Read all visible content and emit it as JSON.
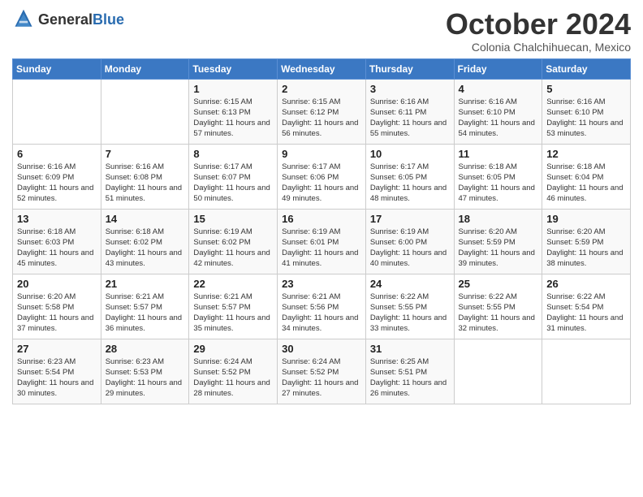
{
  "header": {
    "logo_general": "General",
    "logo_blue": "Blue",
    "month_title": "October 2024",
    "subtitle": "Colonia Chalchihuecan, Mexico"
  },
  "days_of_week": [
    "Sunday",
    "Monday",
    "Tuesday",
    "Wednesday",
    "Thursday",
    "Friday",
    "Saturday"
  ],
  "weeks": [
    [
      {
        "day": "",
        "info": ""
      },
      {
        "day": "",
        "info": ""
      },
      {
        "day": "1",
        "info": "Sunrise: 6:15 AM\nSunset: 6:13 PM\nDaylight: 11 hours and 57 minutes."
      },
      {
        "day": "2",
        "info": "Sunrise: 6:15 AM\nSunset: 6:12 PM\nDaylight: 11 hours and 56 minutes."
      },
      {
        "day": "3",
        "info": "Sunrise: 6:16 AM\nSunset: 6:11 PM\nDaylight: 11 hours and 55 minutes."
      },
      {
        "day": "4",
        "info": "Sunrise: 6:16 AM\nSunset: 6:10 PM\nDaylight: 11 hours and 54 minutes."
      },
      {
        "day": "5",
        "info": "Sunrise: 6:16 AM\nSunset: 6:10 PM\nDaylight: 11 hours and 53 minutes."
      }
    ],
    [
      {
        "day": "6",
        "info": "Sunrise: 6:16 AM\nSunset: 6:09 PM\nDaylight: 11 hours and 52 minutes."
      },
      {
        "day": "7",
        "info": "Sunrise: 6:16 AM\nSunset: 6:08 PM\nDaylight: 11 hours and 51 minutes."
      },
      {
        "day": "8",
        "info": "Sunrise: 6:17 AM\nSunset: 6:07 PM\nDaylight: 11 hours and 50 minutes."
      },
      {
        "day": "9",
        "info": "Sunrise: 6:17 AM\nSunset: 6:06 PM\nDaylight: 11 hours and 49 minutes."
      },
      {
        "day": "10",
        "info": "Sunrise: 6:17 AM\nSunset: 6:05 PM\nDaylight: 11 hours and 48 minutes."
      },
      {
        "day": "11",
        "info": "Sunrise: 6:18 AM\nSunset: 6:05 PM\nDaylight: 11 hours and 47 minutes."
      },
      {
        "day": "12",
        "info": "Sunrise: 6:18 AM\nSunset: 6:04 PM\nDaylight: 11 hours and 46 minutes."
      }
    ],
    [
      {
        "day": "13",
        "info": "Sunrise: 6:18 AM\nSunset: 6:03 PM\nDaylight: 11 hours and 45 minutes."
      },
      {
        "day": "14",
        "info": "Sunrise: 6:18 AM\nSunset: 6:02 PM\nDaylight: 11 hours and 43 minutes."
      },
      {
        "day": "15",
        "info": "Sunrise: 6:19 AM\nSunset: 6:02 PM\nDaylight: 11 hours and 42 minutes."
      },
      {
        "day": "16",
        "info": "Sunrise: 6:19 AM\nSunset: 6:01 PM\nDaylight: 11 hours and 41 minutes."
      },
      {
        "day": "17",
        "info": "Sunrise: 6:19 AM\nSunset: 6:00 PM\nDaylight: 11 hours and 40 minutes."
      },
      {
        "day": "18",
        "info": "Sunrise: 6:20 AM\nSunset: 5:59 PM\nDaylight: 11 hours and 39 minutes."
      },
      {
        "day": "19",
        "info": "Sunrise: 6:20 AM\nSunset: 5:59 PM\nDaylight: 11 hours and 38 minutes."
      }
    ],
    [
      {
        "day": "20",
        "info": "Sunrise: 6:20 AM\nSunset: 5:58 PM\nDaylight: 11 hours and 37 minutes."
      },
      {
        "day": "21",
        "info": "Sunrise: 6:21 AM\nSunset: 5:57 PM\nDaylight: 11 hours and 36 minutes."
      },
      {
        "day": "22",
        "info": "Sunrise: 6:21 AM\nSunset: 5:57 PM\nDaylight: 11 hours and 35 minutes."
      },
      {
        "day": "23",
        "info": "Sunrise: 6:21 AM\nSunset: 5:56 PM\nDaylight: 11 hours and 34 minutes."
      },
      {
        "day": "24",
        "info": "Sunrise: 6:22 AM\nSunset: 5:55 PM\nDaylight: 11 hours and 33 minutes."
      },
      {
        "day": "25",
        "info": "Sunrise: 6:22 AM\nSunset: 5:55 PM\nDaylight: 11 hours and 32 minutes."
      },
      {
        "day": "26",
        "info": "Sunrise: 6:22 AM\nSunset: 5:54 PM\nDaylight: 11 hours and 31 minutes."
      }
    ],
    [
      {
        "day": "27",
        "info": "Sunrise: 6:23 AM\nSunset: 5:54 PM\nDaylight: 11 hours and 30 minutes."
      },
      {
        "day": "28",
        "info": "Sunrise: 6:23 AM\nSunset: 5:53 PM\nDaylight: 11 hours and 29 minutes."
      },
      {
        "day": "29",
        "info": "Sunrise: 6:24 AM\nSunset: 5:52 PM\nDaylight: 11 hours and 28 minutes."
      },
      {
        "day": "30",
        "info": "Sunrise: 6:24 AM\nSunset: 5:52 PM\nDaylight: 11 hours and 27 minutes."
      },
      {
        "day": "31",
        "info": "Sunrise: 6:25 AM\nSunset: 5:51 PM\nDaylight: 11 hours and 26 minutes."
      },
      {
        "day": "",
        "info": ""
      },
      {
        "day": "",
        "info": ""
      }
    ]
  ]
}
